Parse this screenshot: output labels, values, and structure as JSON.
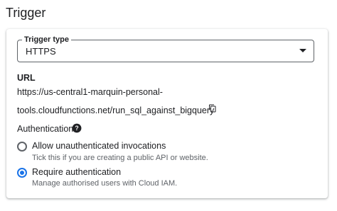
{
  "section": {
    "title": "Trigger"
  },
  "trigger_type": {
    "legend": "Trigger type",
    "value": "HTTPS",
    "icon": "chevron-down-icon"
  },
  "url": {
    "label": "URL",
    "line1": "https://us-central1-marquin-personal-",
    "line2": "tools.cloudfunctions.net/run_sql_against_bigquery",
    "copy_icon": "copy-icon"
  },
  "authentication": {
    "label": "Authentication",
    "help_icon": "help-icon",
    "options": [
      {
        "label": "Allow unauthenticated invocations",
        "description": "Tick this if you are creating a public API or website.",
        "selected": false
      },
      {
        "label": "Require authentication",
        "description": "Manage authorised users with Cloud IAM.",
        "selected": true
      }
    ]
  },
  "colors": {
    "accent": "#1a73e8",
    "text": "#202124",
    "secondary": "#5f6368"
  }
}
